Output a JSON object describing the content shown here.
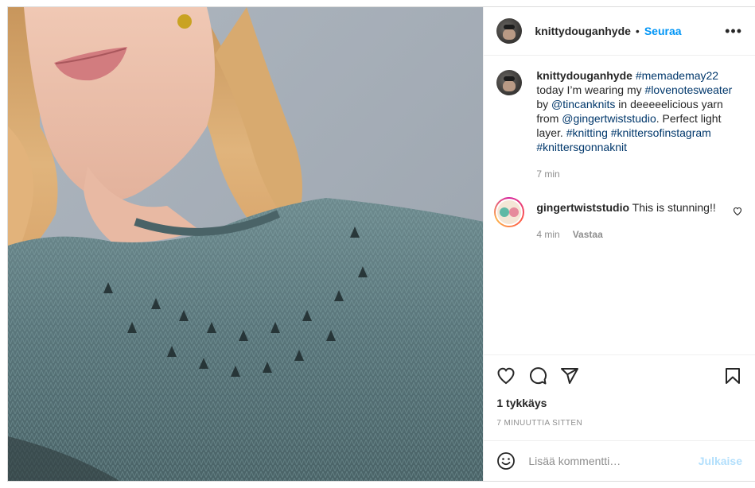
{
  "header": {
    "username": "knittydouganhyde",
    "separator": "•",
    "follow_label": "Seuraa",
    "more_icon": "more-horizontal-icon"
  },
  "caption": {
    "username": "knittydouganhyde",
    "parts": {
      "tag1": "#memademay22",
      "text1": "today I’m wearing my",
      "tag2": "#lovenotesweater",
      "text2": "by",
      "mention1": "@tincanknits",
      "text3": "in deeeeelicious yarn from",
      "mention2": "@gingertwiststudio",
      "text4": ". Perfect light layer.",
      "tag3": "#knitting",
      "tag4": "#knittersofinstagram",
      "tag5": "#knittersgonnaknit"
    },
    "time": "7 min"
  },
  "comment": {
    "username": "gingertwiststudio",
    "text": "This is stunning!!",
    "time": "4 min",
    "reply_label": "Vastaa"
  },
  "actions": {
    "icons": [
      "heart-icon",
      "comment-icon",
      "share-icon",
      "bookmark-icon"
    ],
    "likes": "1 tykkäys",
    "timestamp": "7 MINUUTTIA SITTEN"
  },
  "add_comment": {
    "placeholder": "Lisää kommentti…",
    "publish_label": "Julkaise"
  },
  "colors": {
    "accent": "#0095f6",
    "link": "#00376b",
    "muted": "#8e8e8e",
    "publish_disabled": "#b2dffc"
  }
}
